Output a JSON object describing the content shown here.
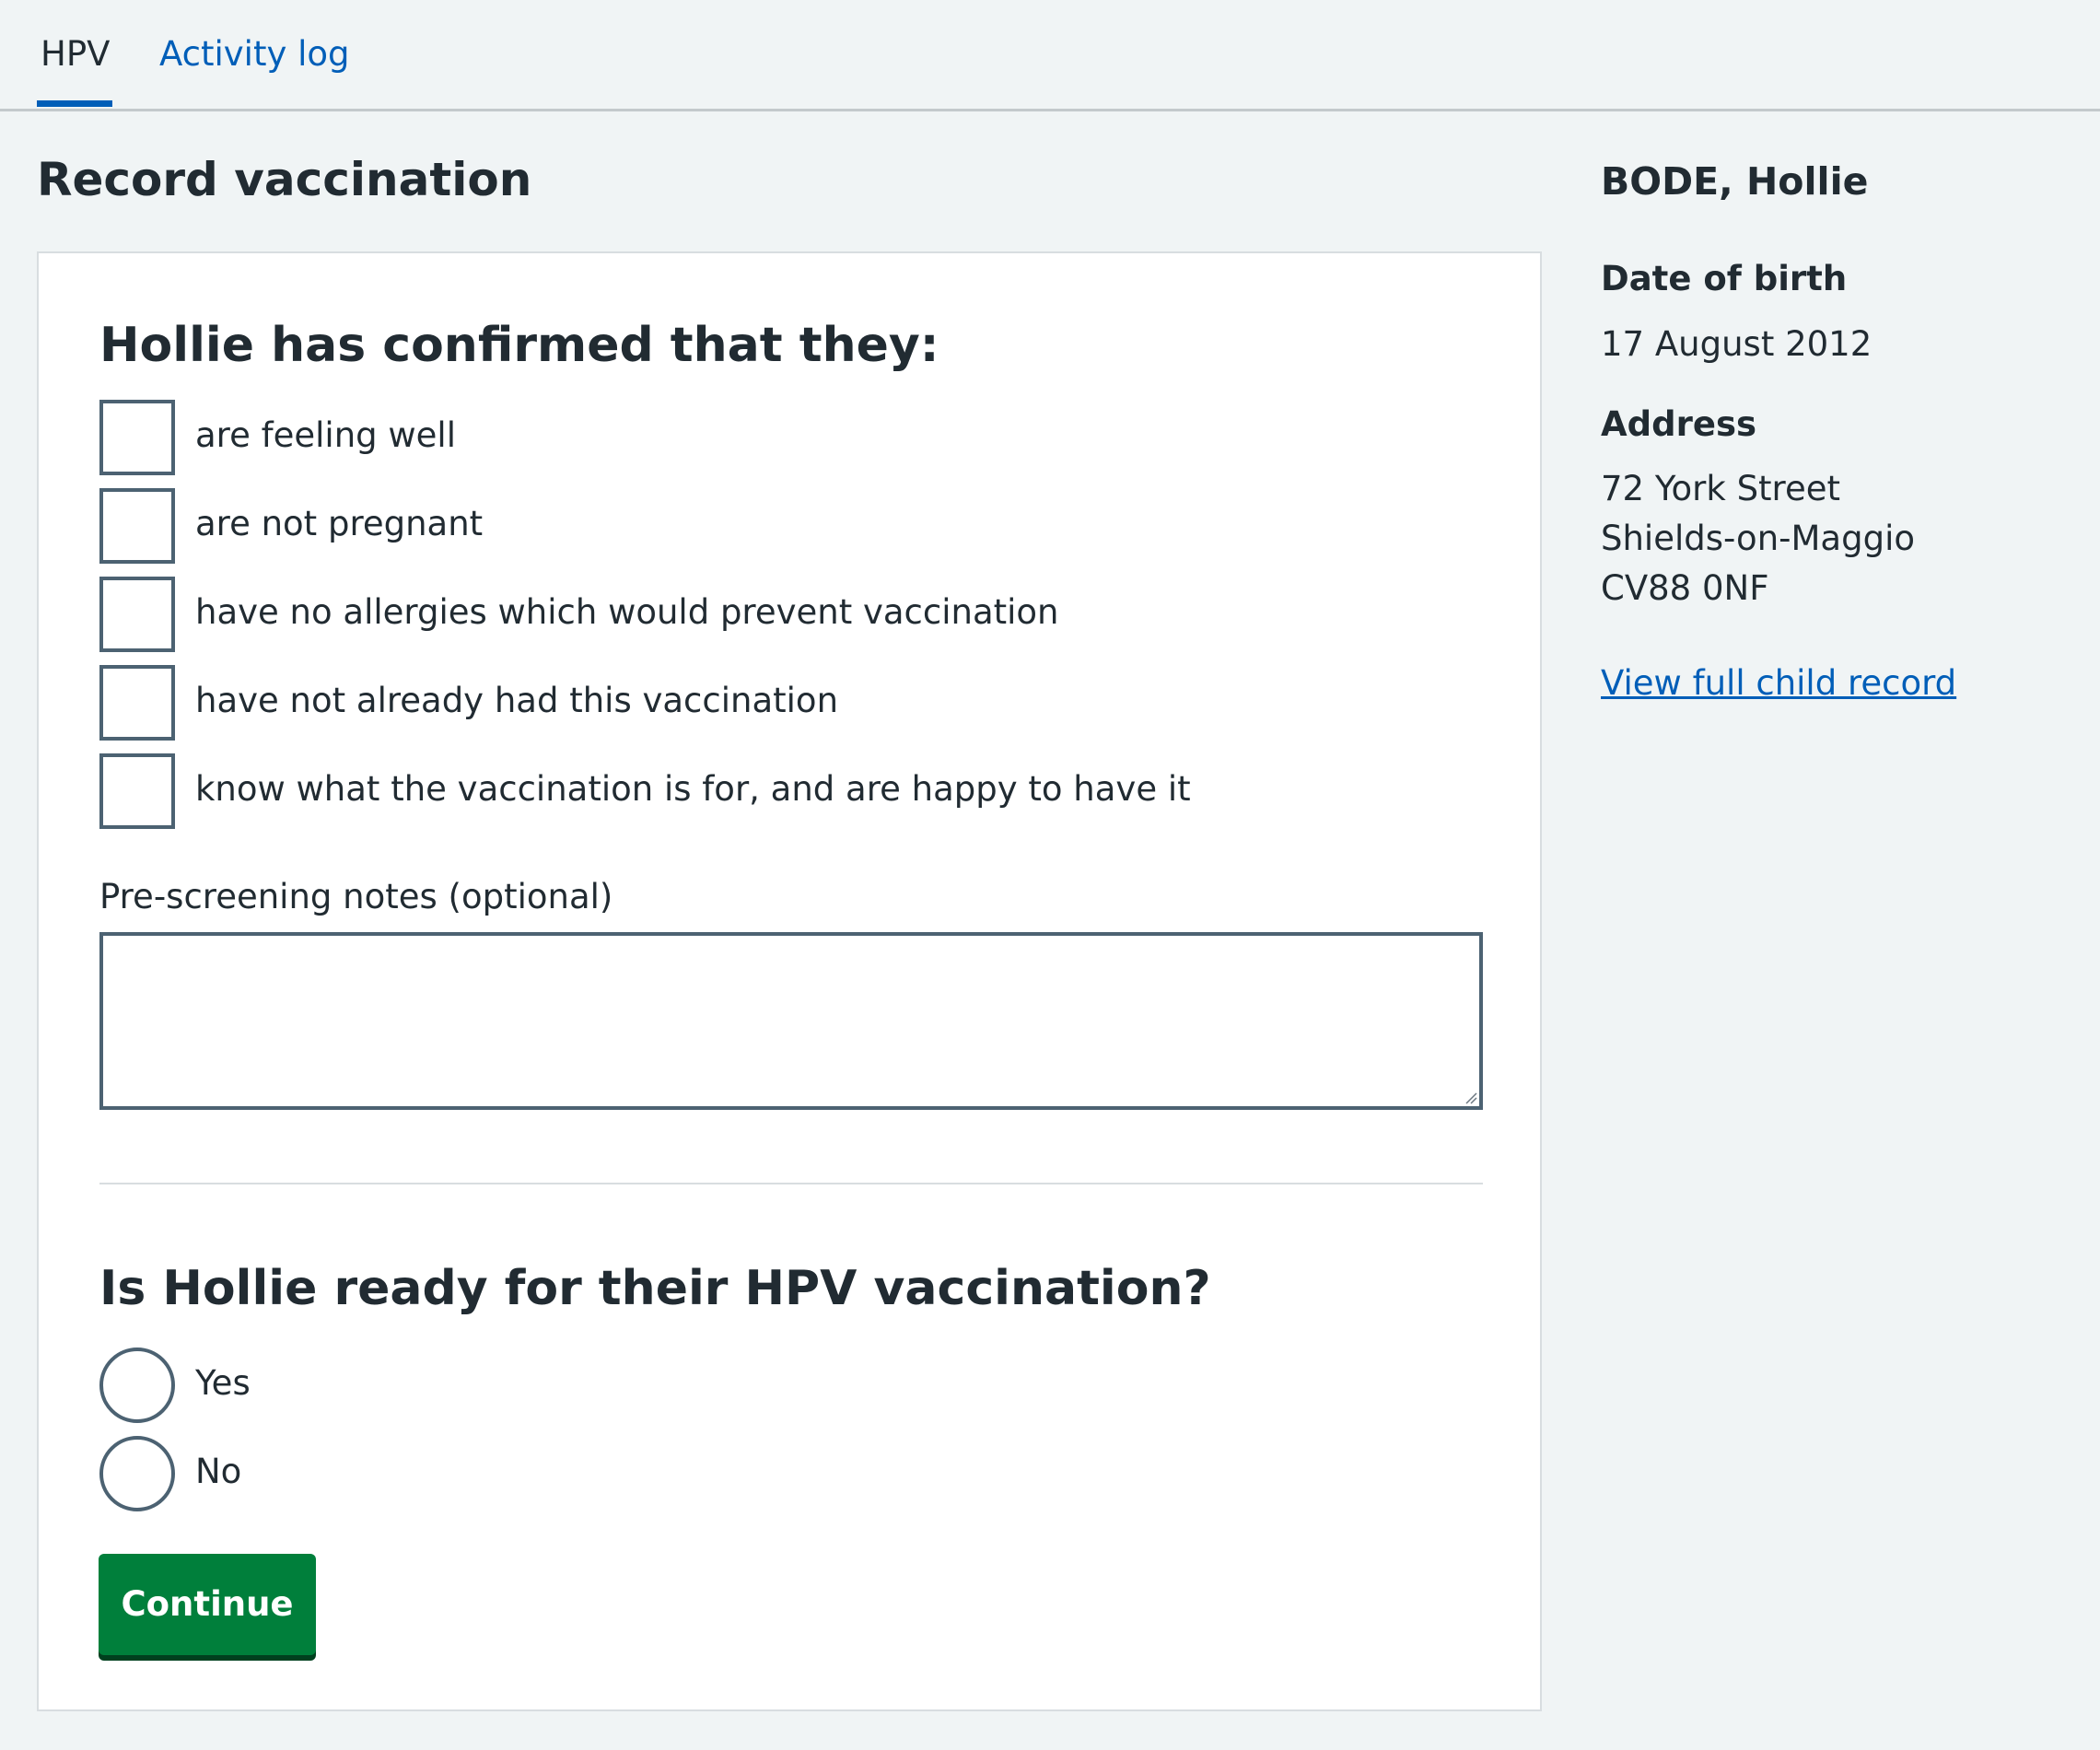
{
  "tabs": {
    "items": [
      {
        "label": "HPV"
      },
      {
        "label": "Activity log"
      }
    ]
  },
  "page": {
    "title": "Record vaccination"
  },
  "pre_screening": {
    "heading": "Hollie has confirmed that they:",
    "checks": [
      {
        "label": "are feeling well"
      },
      {
        "label": "are not pregnant"
      },
      {
        "label": "have no allergies which would prevent vaccination"
      },
      {
        "label": "have not already had this vaccination"
      },
      {
        "label": "know what the vaccination is for, and are happy to have it"
      }
    ],
    "notes_label": "Pre-screening notes (optional)",
    "notes_value": ""
  },
  "readiness": {
    "heading": "Is Hollie ready for their HPV vaccination?",
    "options": [
      {
        "label": "Yes"
      },
      {
        "label": "No"
      }
    ]
  },
  "actions": {
    "continue_label": "Continue"
  },
  "patient": {
    "name": "BODE, Hollie",
    "dob_label": "Date of birth",
    "dob": "17 August 2012",
    "address_label": "Address",
    "address_lines": [
      "72 York Street",
      "Shields-on-Maggio",
      "CV88 0NF"
    ],
    "record_link": "View full child record"
  },
  "colors": {
    "link": "#005eb8",
    "primary_button": "#007f3b",
    "text": "#212b32",
    "page_background": "#f0f4f5",
    "control_border": "#4c6272"
  }
}
